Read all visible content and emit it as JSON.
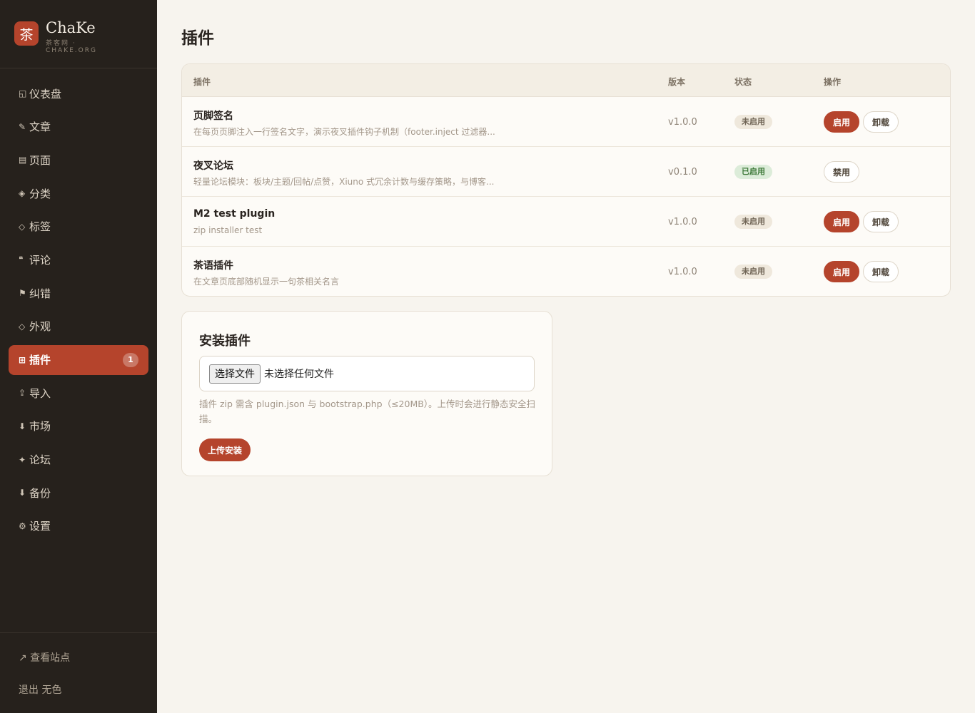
{
  "brand": {
    "logo_char": "茶",
    "name": "ChaKe",
    "sub1": "茶客网 ·",
    "sub2": "CHAKE.ORG"
  },
  "sidebar": {
    "items": [
      {
        "icon": "◱",
        "label": "仪表盘"
      },
      {
        "icon": "✎",
        "label": "文章"
      },
      {
        "icon": "▤",
        "label": "页面"
      },
      {
        "icon": "◈",
        "label": "分类"
      },
      {
        "icon": "◇",
        "label": "标签"
      },
      {
        "icon": "❝",
        "label": "评论"
      },
      {
        "icon": "⚑",
        "label": "纠错"
      },
      {
        "icon": "◇",
        "label": "外观"
      },
      {
        "icon": "⊞",
        "label": "插件",
        "badge": "1"
      },
      {
        "icon": "⇪",
        "label": "导入"
      },
      {
        "icon": "⬇",
        "label": "市场"
      },
      {
        "icon": "✦",
        "label": "论坛"
      },
      {
        "icon": "⬇",
        "label": "备份"
      },
      {
        "icon": "⚙",
        "label": "设置"
      }
    ],
    "view_site": "↗ 查看站点",
    "logout": "退出 无色"
  },
  "page": {
    "title": "插件"
  },
  "table": {
    "headers": {
      "plugin": "插件",
      "version": "版本",
      "status": "状态",
      "actions": "操作"
    },
    "rows": [
      {
        "name": "页脚签名",
        "desc": "在每页页脚注入一行签名文字，演示夜叉插件钩子机制（footer.inject 过滤器...",
        "version": "v1.0.0",
        "status": "未启用",
        "primary": "启用",
        "secondary": "卸载"
      },
      {
        "name": "夜叉论坛",
        "desc": "轻量论坛模块：板块/主题/回帖/点赞，Xiuno 式冗余计数与缓存策略，与博客...",
        "version": "v0.1.0",
        "status": "已启用",
        "secondary": "禁用"
      },
      {
        "name": "M2 test plugin",
        "desc": "zip installer test",
        "version": "v1.0.0",
        "status": "未启用",
        "primary": "启用",
        "secondary": "卸载"
      },
      {
        "name": "茶语插件",
        "desc": "在文章页底部随机显示一句茶相关名言",
        "version": "v1.0.0",
        "status": "未启用",
        "primary": "启用",
        "secondary": "卸载"
      }
    ]
  },
  "install": {
    "title": "安装插件",
    "choose_file": "选择文件",
    "no_file": "未选择任何文件",
    "hint": "插件 zip 需含 plugin.json 与 bootstrap.php（≤20MB）。上传时会进行静态安全扫描。",
    "upload": "上传安装"
  },
  "colors": {
    "accent": "#b5442c",
    "sidebar_bg": "#26211c",
    "page_bg": "#f7f4ee"
  }
}
